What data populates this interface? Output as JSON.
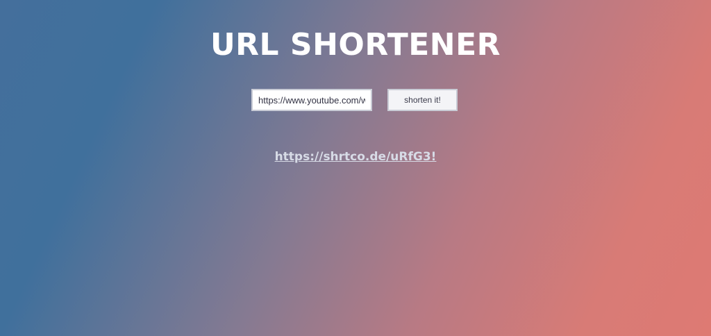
{
  "page": {
    "title": "URL SHORTENER"
  },
  "form": {
    "url_value": "https://www.youtube.com/w",
    "button_label": "shorten it!"
  },
  "result": {
    "short_url": "https://shrtco.de/uRfG3!"
  },
  "colors": {
    "gradient_start": "#40709c",
    "gradient_end": "#de7a73",
    "title": "#ffffff",
    "link": "#d7dbe6"
  }
}
